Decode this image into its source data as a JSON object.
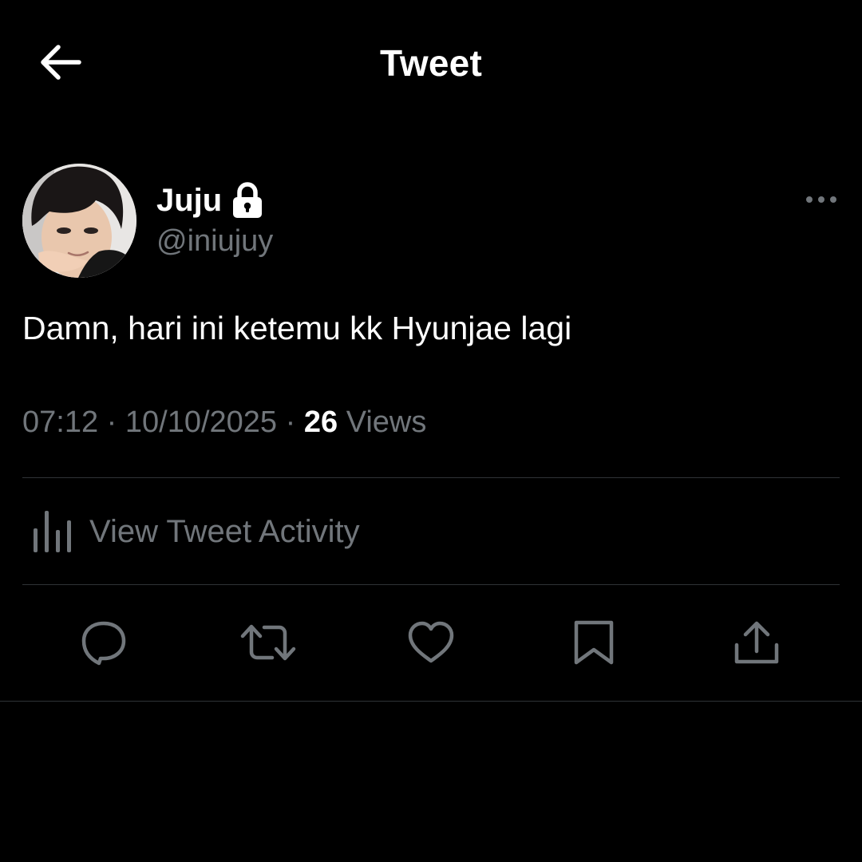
{
  "header": {
    "title": "Tweet",
    "back_icon": "arrow-left-icon"
  },
  "author": {
    "display_name": "Juju",
    "handle": "@iniujuy",
    "protected_icon": "lock-icon",
    "more_icon": "more-horizontal-icon"
  },
  "tweet": {
    "text": "Damn, hari ini ketemu kk Hyunjae lagi",
    "time": "07:12",
    "separator": "·",
    "date": "10/10/2025",
    "views_count": "26",
    "views_label": "Views"
  },
  "activity": {
    "icon": "bar-chart-icon",
    "label": "View Tweet Activity"
  },
  "actions": [
    {
      "name": "reply",
      "icon": "reply-icon"
    },
    {
      "name": "retweet",
      "icon": "retweet-icon"
    },
    {
      "name": "like",
      "icon": "heart-icon"
    },
    {
      "name": "bookmark",
      "icon": "bookmark-icon"
    },
    {
      "name": "share",
      "icon": "share-icon"
    }
  ],
  "colors": {
    "background": "#000000",
    "primary_text": "#ffffff",
    "secondary_text": "#71767b",
    "divider": "#2f3336"
  }
}
